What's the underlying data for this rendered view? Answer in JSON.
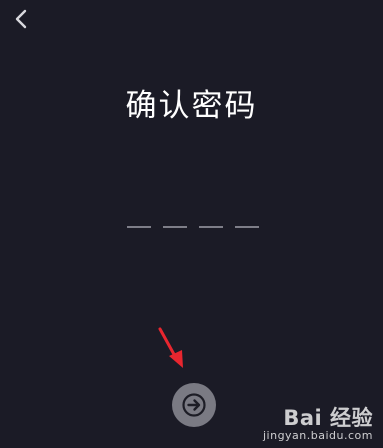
{
  "header": {
    "back_icon": "chevron-left-icon"
  },
  "main": {
    "title": "确认密码",
    "pin": {
      "digit_count": 4,
      "entered": ""
    },
    "next_icon": "arrow-right-icon"
  },
  "annotation": {
    "arrow_icon": "red-pointer-arrow",
    "color": "#e8262f"
  },
  "watermark": {
    "logo_text": "Bai 经验",
    "url": "jingyan.baidu.com"
  },
  "colors": {
    "background": "#1b1b26",
    "title": "#ffffff",
    "pin_underline": "#7e7e88",
    "next_button": "#7a7a83"
  }
}
